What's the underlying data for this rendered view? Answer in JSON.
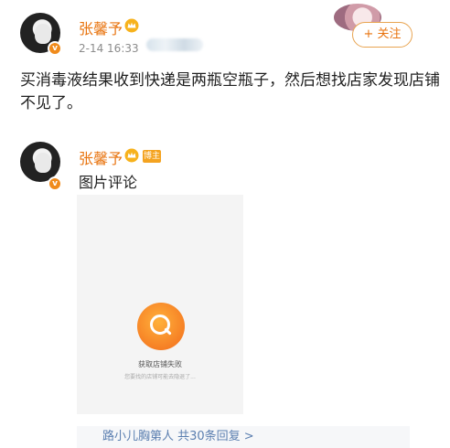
{
  "post": {
    "author": "张馨予",
    "timestamp": "2-14 16:33",
    "follow_label": "+ 关注",
    "text": "买消毒液结果收到快递是两瓶空瓶子，然后想找店家发现店铺不见了。"
  },
  "comment": {
    "author": "张馨予",
    "badge": "博主",
    "text": "图片评论",
    "image": {
      "title": "获取店铺失败",
      "subtitle": "您要找的店铺可能去隐退了..."
    },
    "replies_link": "路小儿胸第人 共30条回复 >"
  },
  "colors": {
    "accent": "#e8730e",
    "link": "#5b7fb0",
    "badge": "#f4a320"
  },
  "icons": [
    "avatar",
    "verified-badge-icon",
    "crown-icon",
    "store-search-icon"
  ]
}
